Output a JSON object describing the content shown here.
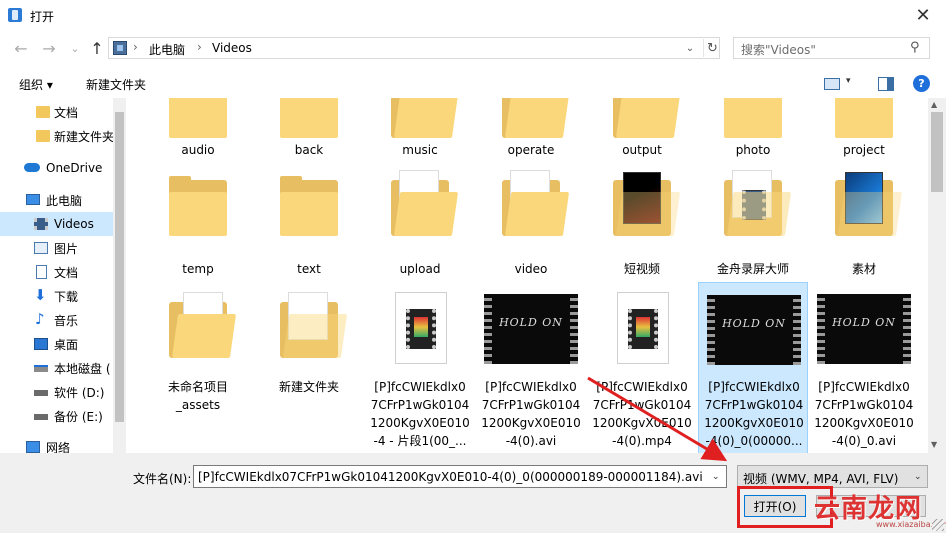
{
  "window": {
    "title": "打开",
    "close_glyph": "✕"
  },
  "nav": {
    "back_glyph": "←",
    "forward_glyph": "→",
    "recent_glyph": "⌄",
    "up_glyph": "↑",
    "breadcrumb": [
      "此电脑",
      "Videos"
    ],
    "separator": "›",
    "refresh_glyph": "↻",
    "dropdown_glyph": "⌄"
  },
  "search": {
    "placeholder": "搜索\"Videos\"",
    "icon_glyph": "⚲"
  },
  "toolbar": {
    "organize_label": "组织 ▾",
    "new_folder_label": "新建文件夹",
    "help_glyph": "?",
    "view_dropdown_glyph": "▾"
  },
  "sidebar": {
    "items": [
      {
        "label": "文档",
        "icon": "folder-icon"
      },
      {
        "label": "新建文件夹",
        "icon": "folder-icon"
      },
      {
        "label": "OneDrive",
        "icon": "cloud-icon"
      },
      {
        "label": "此电脑",
        "icon": "computer-icon"
      },
      {
        "label": "Videos",
        "icon": "video-folder-icon",
        "selected": true
      },
      {
        "label": "图片",
        "icon": "pictures-icon"
      },
      {
        "label": "文档",
        "icon": "documents-icon"
      },
      {
        "label": "下载",
        "icon": "download-icon"
      },
      {
        "label": "音乐",
        "icon": "music-icon"
      },
      {
        "label": "桌面",
        "icon": "desktop-icon"
      },
      {
        "label": "本地磁盘 (",
        "icon": "drive-icon"
      },
      {
        "label": "软件 (D:)",
        "icon": "drive-icon"
      },
      {
        "label": "备份 (E:)",
        "icon": "drive-icon"
      },
      {
        "label": "网络",
        "icon": "network-icon"
      }
    ]
  },
  "files": {
    "row1": [
      {
        "name": "audio",
        "type": "folder"
      },
      {
        "name": "back",
        "type": "folder"
      },
      {
        "name": "music",
        "type": "folder-docs"
      },
      {
        "name": "operate",
        "type": "folder-docs"
      },
      {
        "name": "output",
        "type": "folder-docs"
      },
      {
        "name": "photo",
        "type": "folder"
      },
      {
        "name": "project",
        "type": "folder"
      }
    ],
    "row2": [
      {
        "name": "temp",
        "type": "folder"
      },
      {
        "name": "text",
        "type": "folder"
      },
      {
        "name": "upload",
        "type": "folder-paper"
      },
      {
        "name": "video",
        "type": "folder-paper"
      },
      {
        "name": "短视频",
        "type": "folder-image-red"
      },
      {
        "name": "金舟录屏大师",
        "type": "folder-video"
      },
      {
        "name": "素材",
        "type": "folder-image-win"
      }
    ],
    "row3": [
      {
        "name": "未命名项目\n_assets",
        "type": "folder-docs"
      },
      {
        "name": "新建文件夹",
        "type": "folder-mp4"
      },
      {
        "name": "[P]fcCWIEkdlx0\n7CFrP1wGk0104\n1200KgvX0E010\n-4 - 片段1(00_...",
        "type": "video-doc"
      },
      {
        "name": "[P]fcCWIEkdlx0\n7CFrP1wGk0104\n1200KgvX0E010\n-4(0).avi",
        "type": "video-thumb",
        "thumb_text": "HOLD ON"
      },
      {
        "name": "[P]fcCWIEkdlx0\n7CFrP1wGk0104\n1200KgvX0E010\n-4(0).mp4",
        "type": "video-doc"
      },
      {
        "name": "[P]fcCWIEkdlx0\n7CFrP1wGk0104\n1200KgvX0E010\n-4(0)_0(00000...",
        "type": "video-thumb",
        "thumb_text": "HOLD ON",
        "selected": true
      },
      {
        "name": "[P]fcCWIEkdlx0\n7CFrP1wGk0104\n1200KgvX0E010\n-4(0)_0.avi",
        "type": "video-thumb",
        "thumb_text": "HOLD ON"
      }
    ]
  },
  "bottom": {
    "filename_label": "文件名(N):",
    "filename_value": "[P]fcCWIEkdlx07CFrP1wGk01041200KgvX0E010-4(0)_0(000000189-000001184).avi",
    "filetype_value": "视频 (WMV, MP4, AVI, FLV)",
    "dropdown_glyph": "⌄",
    "open_label": "打开(O)"
  },
  "watermark": {
    "text": "云南龙网",
    "sub": "www.xiazaiba.com"
  },
  "colors": {
    "accent": "#0078d7",
    "selection": "#cce8ff",
    "folder": "#f9d77a",
    "annotation": "#e02020"
  }
}
